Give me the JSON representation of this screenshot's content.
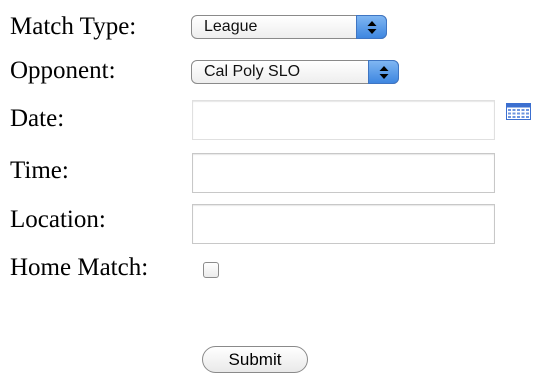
{
  "form": {
    "match_type": {
      "label": "Match Type:",
      "selected": "League"
    },
    "opponent": {
      "label": "Opponent:",
      "selected": "Cal Poly SLO"
    },
    "date": {
      "label": "Date:",
      "value": ""
    },
    "time": {
      "label": "Time:",
      "value": ""
    },
    "location": {
      "label": "Location:",
      "value": ""
    },
    "home_match": {
      "label": "Home Match:",
      "checked": false
    },
    "submit_label": "Submit"
  },
  "icons": {
    "select_arrows": "up-down-arrows-icon",
    "calendar": "calendar-icon"
  },
  "colors": {
    "select_accent": "#4a8fe6",
    "calendar_blue": "#3b6fd0"
  }
}
